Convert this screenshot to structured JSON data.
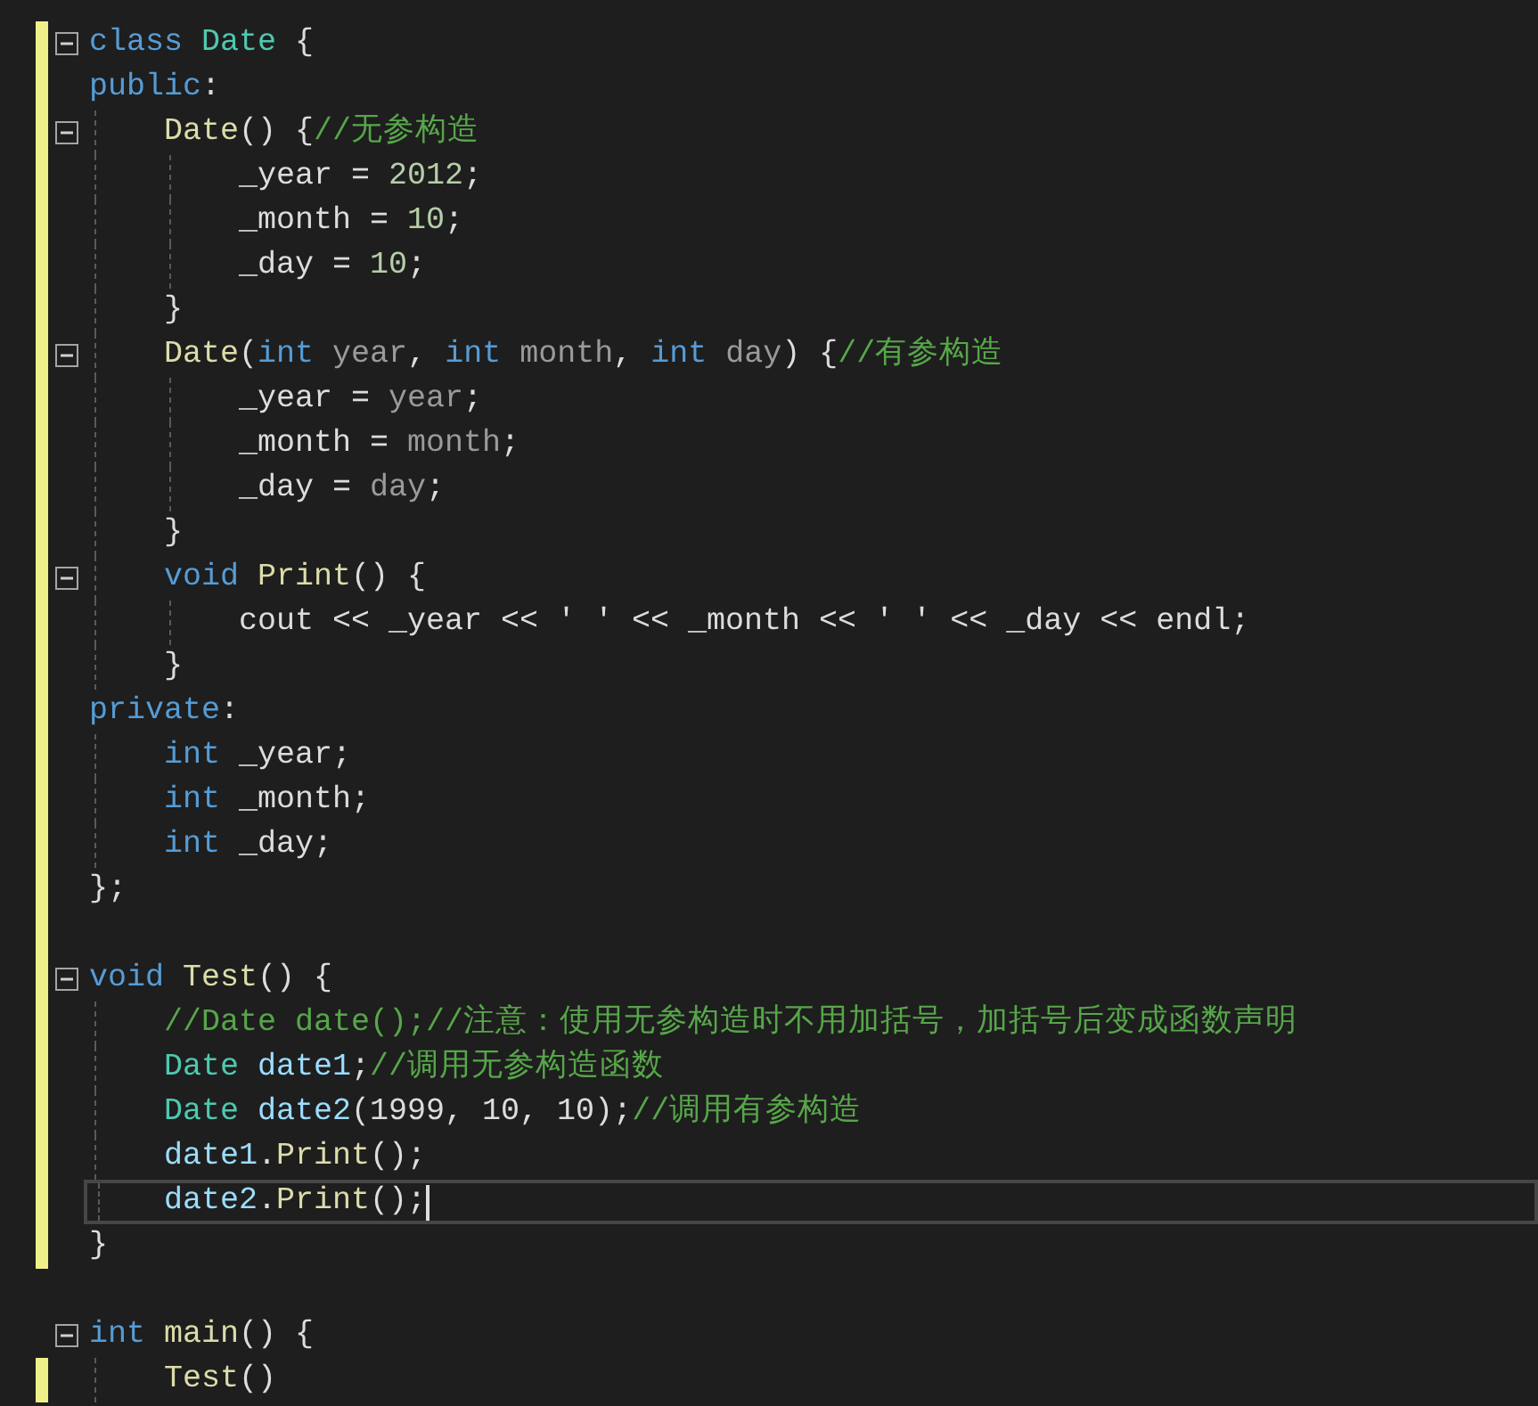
{
  "editor": {
    "lines": [
      {
        "changed": true,
        "fold": true,
        "current": false,
        "tokens": [
          {
            "kind": "kw",
            "text": "class "
          },
          {
            "kind": "type",
            "text": "Date"
          },
          {
            "kind": "plain",
            "text": " {"
          }
        ]
      },
      {
        "changed": true,
        "fold": false,
        "current": false,
        "tokens": [
          {
            "kind": "kw",
            "text": "public"
          },
          {
            "kind": "plain",
            "text": ":"
          }
        ]
      },
      {
        "changed": true,
        "fold": true,
        "current": false,
        "tokens": [
          {
            "kind": "fn",
            "text": "    Date"
          },
          {
            "kind": "plain",
            "text": "() {"
          },
          {
            "kind": "cm",
            "text": "//无参构造"
          }
        ]
      },
      {
        "changed": true,
        "fold": false,
        "current": false,
        "tokens": [
          {
            "kind": "plain",
            "text": "        _year = "
          },
          {
            "kind": "num",
            "text": "2012"
          },
          {
            "kind": "plain",
            "text": ";"
          }
        ]
      },
      {
        "changed": true,
        "fold": false,
        "current": false,
        "tokens": [
          {
            "kind": "plain",
            "text": "        _month = "
          },
          {
            "kind": "num",
            "text": "10"
          },
          {
            "kind": "plain",
            "text": ";"
          }
        ]
      },
      {
        "changed": true,
        "fold": false,
        "current": false,
        "tokens": [
          {
            "kind": "plain",
            "text": "        _day = "
          },
          {
            "kind": "num",
            "text": "10"
          },
          {
            "kind": "plain",
            "text": ";"
          }
        ]
      },
      {
        "changed": true,
        "fold": false,
        "current": false,
        "tokens": [
          {
            "kind": "plain",
            "text": "    }"
          }
        ]
      },
      {
        "changed": true,
        "fold": true,
        "current": false,
        "tokens": [
          {
            "kind": "fn",
            "text": "    Date"
          },
          {
            "kind": "plain",
            "text": "("
          },
          {
            "kind": "kw",
            "text": "int"
          },
          {
            "kind": "param",
            "text": " year"
          },
          {
            "kind": "plain",
            "text": ", "
          },
          {
            "kind": "kw",
            "text": "int"
          },
          {
            "kind": "param",
            "text": " month"
          },
          {
            "kind": "plain",
            "text": ", "
          },
          {
            "kind": "kw",
            "text": "int"
          },
          {
            "kind": "param",
            "text": " day"
          },
          {
            "kind": "plain",
            "text": ") {"
          },
          {
            "kind": "cm",
            "text": "//有参构造"
          }
        ]
      },
      {
        "changed": true,
        "fold": false,
        "current": false,
        "tokens": [
          {
            "kind": "plain",
            "text": "        _year = "
          },
          {
            "kind": "param",
            "text": "year"
          },
          {
            "kind": "plain",
            "text": ";"
          }
        ]
      },
      {
        "changed": true,
        "fold": false,
        "current": false,
        "tokens": [
          {
            "kind": "plain",
            "text": "        _month = "
          },
          {
            "kind": "param",
            "text": "month"
          },
          {
            "kind": "plain",
            "text": ";"
          }
        ]
      },
      {
        "changed": true,
        "fold": false,
        "current": false,
        "tokens": [
          {
            "kind": "plain",
            "text": "        _day = "
          },
          {
            "kind": "param",
            "text": "day"
          },
          {
            "kind": "plain",
            "text": ";"
          }
        ]
      },
      {
        "changed": true,
        "fold": false,
        "current": false,
        "tokens": [
          {
            "kind": "plain",
            "text": "    }"
          }
        ]
      },
      {
        "changed": true,
        "fold": true,
        "current": false,
        "tokens": [
          {
            "kind": "kw",
            "text": "    void "
          },
          {
            "kind": "fn",
            "text": "Print"
          },
          {
            "kind": "plain",
            "text": "() {"
          }
        ]
      },
      {
        "changed": true,
        "fold": false,
        "current": false,
        "tokens": [
          {
            "kind": "plain",
            "text": "        cout << _year << ' ' << _month << ' ' << _day << endl;"
          }
        ]
      },
      {
        "changed": true,
        "fold": false,
        "current": false,
        "tokens": [
          {
            "kind": "plain",
            "text": "    }"
          }
        ]
      },
      {
        "changed": true,
        "fold": false,
        "current": false,
        "tokens": [
          {
            "kind": "kw",
            "text": "private"
          },
          {
            "kind": "plain",
            "text": ":"
          }
        ]
      },
      {
        "changed": true,
        "fold": false,
        "current": false,
        "tokens": [
          {
            "kind": "kw",
            "text": "    int"
          },
          {
            "kind": "plain",
            "text": " _year;"
          }
        ]
      },
      {
        "changed": true,
        "fold": false,
        "current": false,
        "tokens": [
          {
            "kind": "kw",
            "text": "    int"
          },
          {
            "kind": "plain",
            "text": " _month;"
          }
        ]
      },
      {
        "changed": true,
        "fold": false,
        "current": false,
        "tokens": [
          {
            "kind": "kw",
            "text": "    int"
          },
          {
            "kind": "plain",
            "text": " _day;"
          }
        ]
      },
      {
        "changed": true,
        "fold": false,
        "current": false,
        "tokens": [
          {
            "kind": "plain",
            "text": "};"
          }
        ]
      },
      {
        "changed": true,
        "fold": false,
        "current": false
      },
      {
        "changed": true,
        "fold": true,
        "current": false,
        "tokens": [
          {
            "kind": "kw",
            "text": "void "
          },
          {
            "kind": "fn",
            "text": "Test"
          },
          {
            "kind": "plain",
            "text": "() {"
          }
        ]
      },
      {
        "changed": true,
        "fold": false,
        "current": false,
        "tokens": [
          {
            "kind": "cm",
            "text": "    //Date date();//注意：使用无参构造时不用加括号，加括号后变成函数声明"
          }
        ]
      },
      {
        "changed": true,
        "fold": false,
        "current": false,
        "tokens": [
          {
            "kind": "type",
            "text": "    Date "
          },
          {
            "kind": "var",
            "text": "date1"
          },
          {
            "kind": "plain",
            "text": ";"
          },
          {
            "kind": "cm",
            "text": "//调用无参构造函数"
          }
        ]
      },
      {
        "changed": true,
        "fold": false,
        "current": false,
        "tokens": [
          {
            "kind": "type",
            "text": "    Date "
          },
          {
            "kind": "var",
            "text": "date2"
          },
          {
            "kind": "plain",
            "text": "(1999, 10, 10);"
          },
          {
            "kind": "cm",
            "text": "//调用有参构造"
          }
        ]
      },
      {
        "changed": true,
        "fold": false,
        "current": false,
        "tokens": [
          {
            "kind": "var",
            "text": "    date1"
          },
          {
            "kind": "plain",
            "text": "."
          },
          {
            "kind": "fn",
            "text": "Print"
          },
          {
            "kind": "plain",
            "text": "();"
          }
        ]
      },
      {
        "changed": true,
        "fold": false,
        "current": true,
        "tokens": [
          {
            "kind": "var",
            "text": "    date2"
          },
          {
            "kind": "plain",
            "text": "."
          },
          {
            "kind": "fn",
            "text": "Print"
          },
          {
            "kind": "plain",
            "text": "();"
          }
        ]
      },
      {
        "changed": true,
        "fold": false,
        "current": false,
        "tokens": [
          {
            "kind": "plain",
            "text": "}"
          }
        ]
      },
      {
        "changed": false,
        "fold": false,
        "current": false
      },
      {
        "changed": false,
        "fold": true,
        "current": false,
        "tokens": [
          {
            "kind": "kw",
            "text": "int "
          },
          {
            "kind": "fn",
            "text": "main"
          },
          {
            "kind": "plain",
            "text": "() {"
          }
        ]
      },
      {
        "changed": true,
        "fold": false,
        "current": false,
        "tokens": [
          {
            "kind": "fn",
            "text": "    Test"
          },
          {
            "kind": "plain",
            "text": "()"
          }
        ]
      }
    ]
  }
}
